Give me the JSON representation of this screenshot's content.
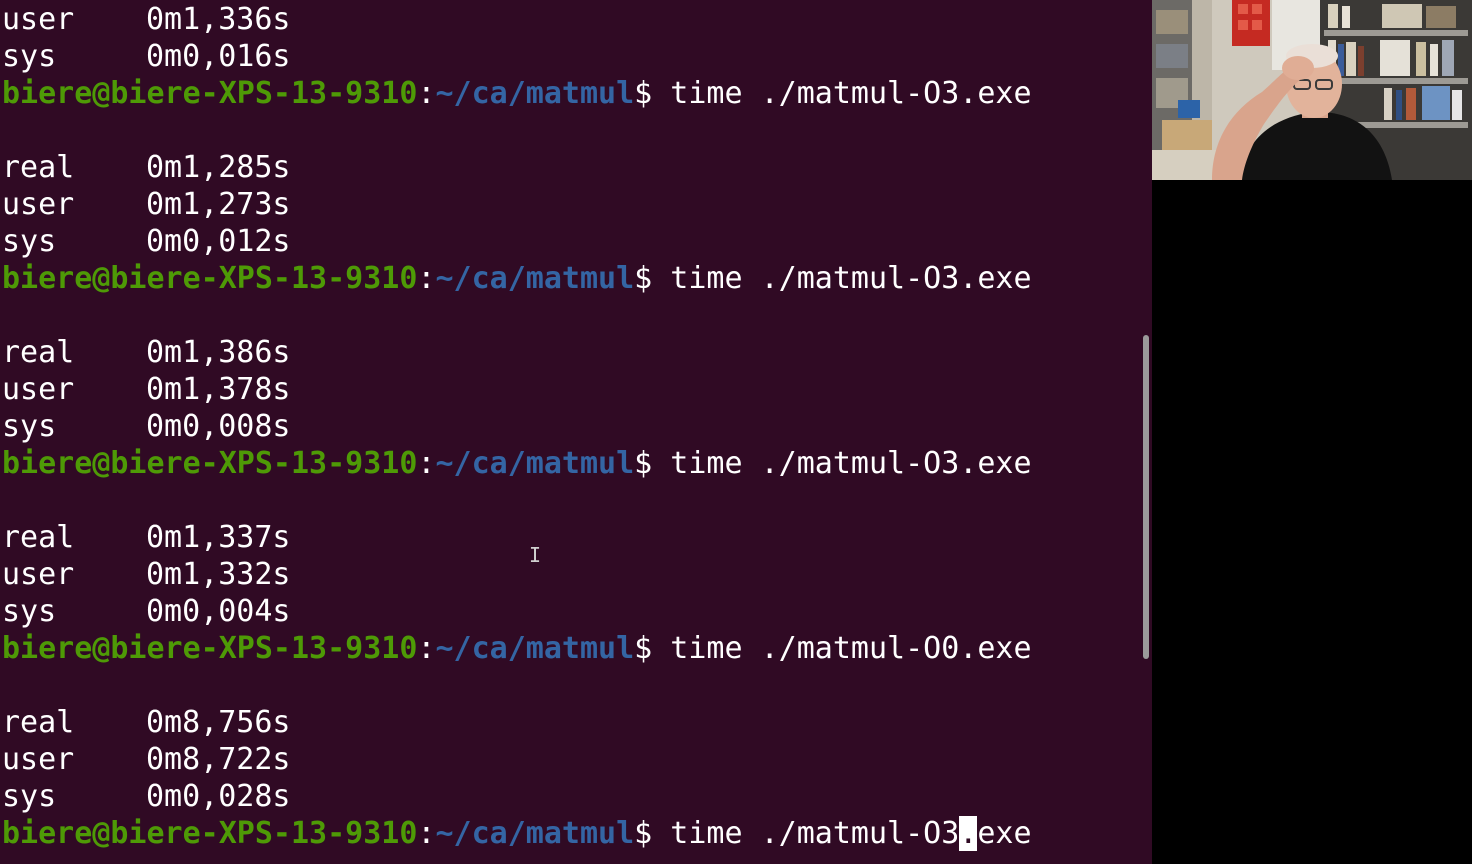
{
  "terminal": {
    "prompt": {
      "user_host": "biere@biere-XPS-13-9310",
      "colon": ":",
      "path": "~/ca/matmul",
      "dollar": "$"
    },
    "lines": [
      {
        "type": "timing",
        "label": "user",
        "value": "0m1,336s"
      },
      {
        "type": "timing",
        "label": "sys",
        "value": "0m0,016s"
      },
      {
        "type": "prompt",
        "command": " time ./matmul-O3.exe"
      },
      {
        "type": "blank"
      },
      {
        "type": "timing",
        "label": "real",
        "value": "0m1,285s"
      },
      {
        "type": "timing",
        "label": "user",
        "value": "0m1,273s"
      },
      {
        "type": "timing",
        "label": "sys",
        "value": "0m0,012s"
      },
      {
        "type": "prompt",
        "command": " time ./matmul-O3.exe"
      },
      {
        "type": "blank"
      },
      {
        "type": "timing",
        "label": "real",
        "value": "0m1,386s"
      },
      {
        "type": "timing",
        "label": "user",
        "value": "0m1,378s"
      },
      {
        "type": "timing",
        "label": "sys",
        "value": "0m0,008s"
      },
      {
        "type": "prompt",
        "command": " time ./matmul-O3.exe"
      },
      {
        "type": "blank"
      },
      {
        "type": "timing",
        "label": "real",
        "value": "0m1,337s"
      },
      {
        "type": "timing",
        "label": "user",
        "value": "0m1,332s"
      },
      {
        "type": "timing",
        "label": "sys",
        "value": "0m0,004s"
      },
      {
        "type": "prompt",
        "command": " time ./matmul-O0.exe"
      },
      {
        "type": "blank"
      },
      {
        "type": "timing",
        "label": "real",
        "value": "0m8,756s"
      },
      {
        "type": "timing",
        "label": "user",
        "value": "0m8,722s"
      },
      {
        "type": "timing",
        "label": "sys",
        "value": "0m0,028s"
      }
    ],
    "current_input": {
      "before_cursor": " time ./matmul-O3",
      "cursor_char": ".",
      "after_cursor": "exe"
    },
    "scroll_position_fraction": 0.62
  },
  "colors": {
    "background": "#300a24",
    "user_host": "#4e9a06",
    "path": "#3465a4",
    "text": "#ffffff"
  },
  "icons": {
    "mouse_pointer": "text-ibeam-cursor-icon"
  }
}
